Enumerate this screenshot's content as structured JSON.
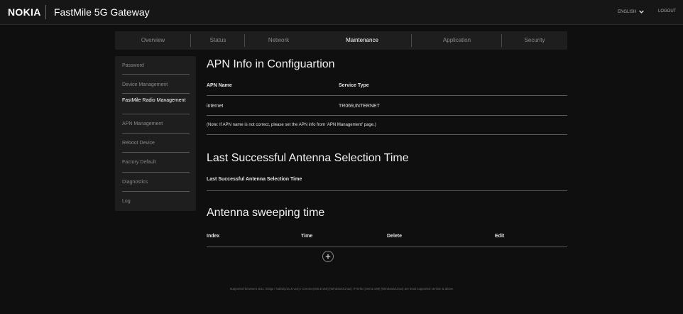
{
  "header": {
    "brand": "NOKIA",
    "product": "FastMile 5G Gateway",
    "language": "ENGLISH",
    "logout": "LOGOUT"
  },
  "tabs": [
    {
      "label": "Overview"
    },
    {
      "label": "Status"
    },
    {
      "label": "Network"
    },
    {
      "label": "Maintenance",
      "active": true
    },
    {
      "label": "Application"
    },
    {
      "label": "Security"
    }
  ],
  "sidebar": {
    "items": [
      {
        "label": "Password"
      },
      {
        "label": "Device Management"
      },
      {
        "label": "FastMile Radio Management",
        "active": true
      },
      {
        "label": "APN Management"
      },
      {
        "label": "Reboot Device"
      },
      {
        "label": "Factory Default"
      },
      {
        "label": "Diagnostics"
      },
      {
        "label": "Log"
      }
    ]
  },
  "apn_section": {
    "title": "APN Info in Configuartion",
    "headers": [
      "APN Name",
      "Service Type"
    ],
    "rows": [
      [
        "internet",
        "TR069,INTERNET"
      ]
    ],
    "note": "(Note: If APN name is not correct, please set the APN info from 'APN Management' page.)"
  },
  "antenna_selection": {
    "title": "Last Successful Antenna Selection Time",
    "label": "Last Successful Antenna Selection Time"
  },
  "antenna_sweeping": {
    "title": "Antenna sweeping time",
    "headers": [
      "Index",
      "Time",
      "Delete",
      "Edit"
    ]
  },
  "footer": {
    "text": "Supported browsers IE11 / Edge / Safari(v11 & v10) / Chrome(v66 & v65) (Windows/Linux) / Firefox (v60 & v59) (Windows/Linux) are least supported version & above"
  },
  "colors": {
    "background": "#0f0f0f",
    "panel": "#1e1e1e",
    "active_text": "#ffffff",
    "inactive_text": "#888888"
  }
}
